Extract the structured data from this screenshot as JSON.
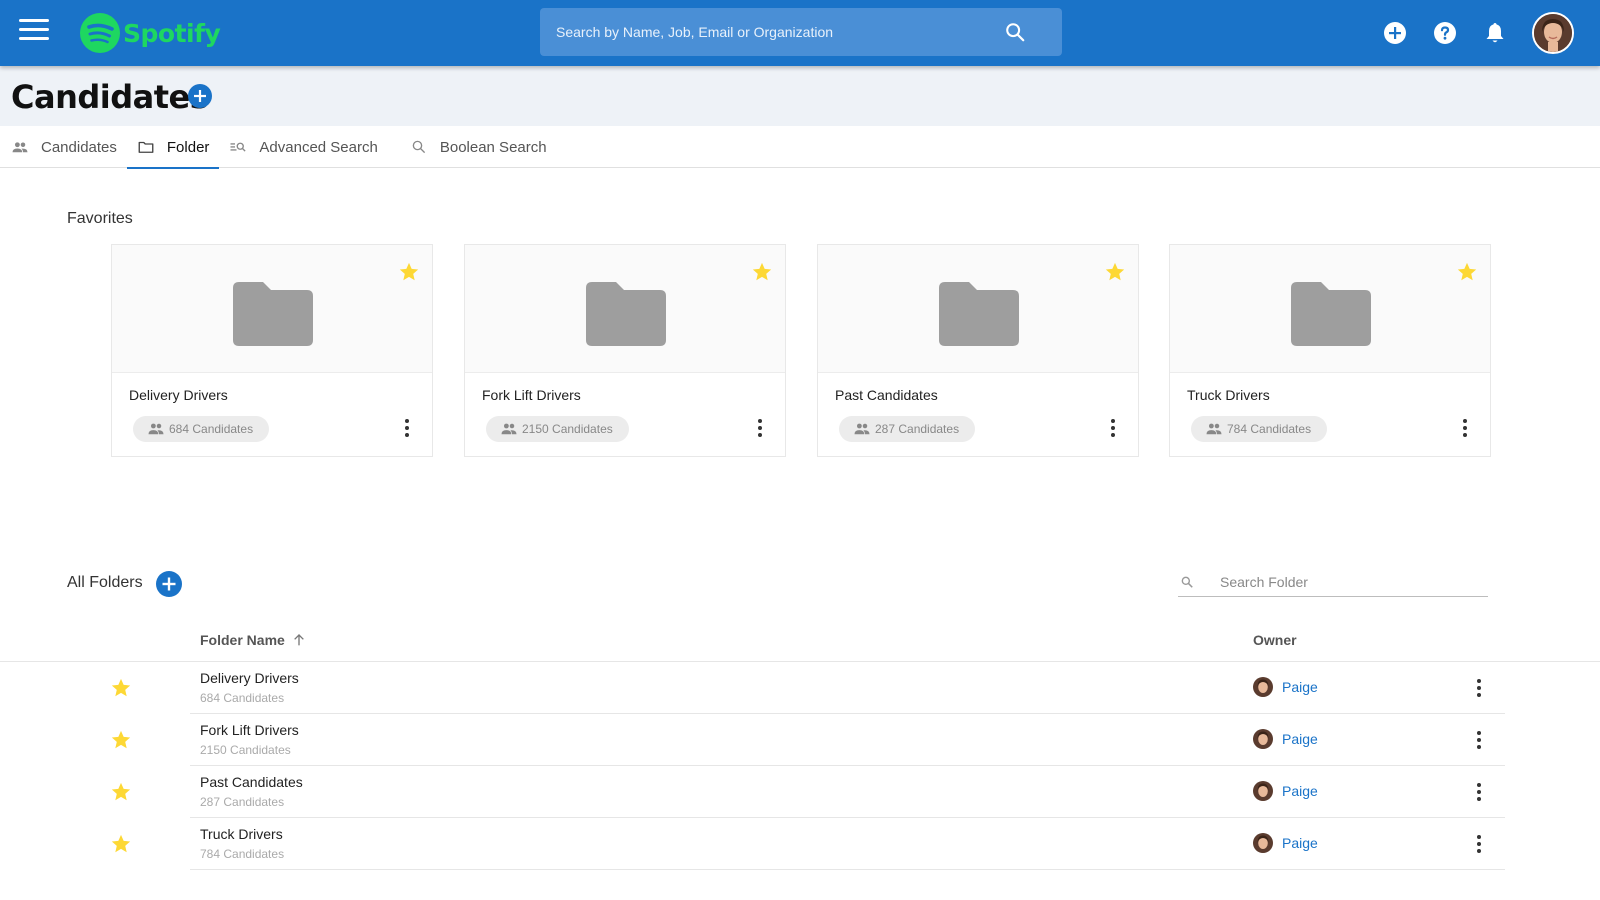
{
  "app": {
    "brand": "Spotify",
    "search_placeholder": "Search by Name, Job, Email or Organization"
  },
  "page": {
    "title": "Candidates"
  },
  "tabs": [
    {
      "label": "Candidates",
      "icon": "people-icon",
      "active": false
    },
    {
      "label": "Folder",
      "icon": "folder-outline-icon",
      "active": true
    },
    {
      "label": "Advanced Search",
      "icon": "advanced-search-icon",
      "active": false
    },
    {
      "label": "Boolean Search",
      "icon": "search-icon",
      "active": false
    }
  ],
  "favorites": {
    "label": "Favorites",
    "cards": [
      {
        "name": "Delivery Drivers",
        "count": "684 Candidates"
      },
      {
        "name": "Fork Lift Drivers",
        "count": "2150 Candidates"
      },
      {
        "name": "Past Candidates",
        "count": "287 Candidates"
      },
      {
        "name": "Truck Drivers",
        "count": "784 Candidates"
      }
    ]
  },
  "all_folders": {
    "label": "All Folders",
    "search_placeholder": "Search Folder",
    "columns": {
      "name": "Folder Name",
      "owner": "Owner"
    },
    "rows": [
      {
        "name": "Delivery Drivers",
        "count": "684 Candidates",
        "owner": "Paige",
        "favorite": true
      },
      {
        "name": "Fork Lift Drivers",
        "count": "2150 Candidates",
        "owner": "Paige",
        "favorite": true
      },
      {
        "name": "Past Candidates",
        "count": "287 Candidates",
        "owner": "Paige",
        "favorite": true
      },
      {
        "name": "Truck Drivers",
        "count": "784 Candidates",
        "owner": "Paige",
        "favorite": true
      }
    ]
  },
  "colors": {
    "topbar": "#1a73c8",
    "brand_green": "#1ed760",
    "star": "#fdd835",
    "link": "#1a73c8"
  }
}
